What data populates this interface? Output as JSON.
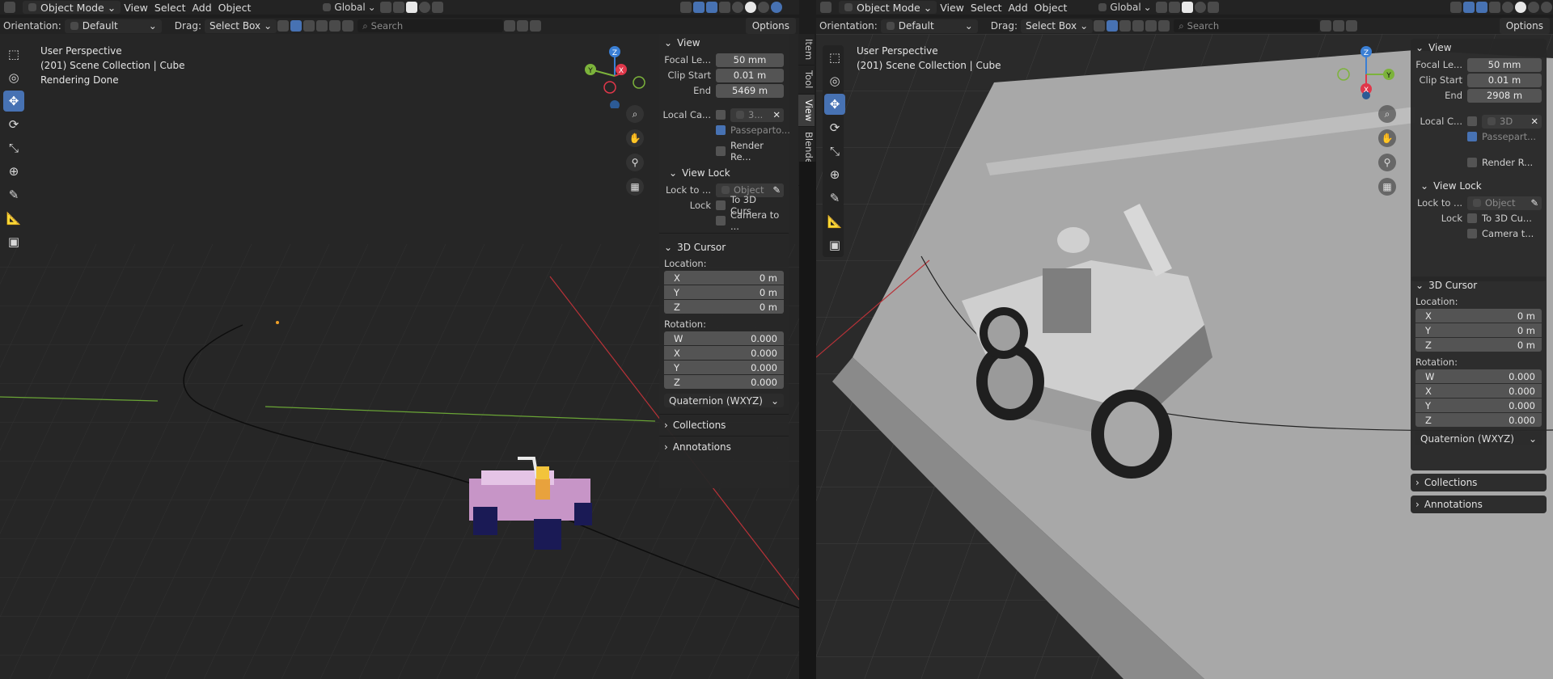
{
  "left": {
    "header": {
      "mode": "Object Mode",
      "menus": [
        "View",
        "Select",
        "Add",
        "Object"
      ],
      "transform": "Global",
      "search_placeholder": "Search",
      "orientation_label": "Orientation:",
      "orientation_value": "Default",
      "drag_label": "Drag:",
      "drag_value": "Select Box",
      "options": "Options"
    },
    "overlay_text": [
      "User Perspective",
      "(201) Scene Collection | Cube",
      "Rendering Done"
    ],
    "tabs": [
      "Item",
      "Tool",
      "View",
      "BlenderKit"
    ],
    "panel": {
      "view_title": "View",
      "focal_label": "Focal Le...",
      "focal_value": "50 mm",
      "clip_start_label": "Clip Start",
      "clip_start_value": "0.01 m",
      "end_label": "End",
      "end_value": "5469 m",
      "local_camera_label": "Local Ca...",
      "local_camera_value": "3...",
      "passepartout_label": "Passeparto...",
      "render_region_label": "Render Re...",
      "view_lock_title": "View Lock",
      "lock_to_label": "Lock to ...",
      "lock_to_value": "Object",
      "lock_label": "Lock",
      "to_3d_cursor_label": "To 3D Curs...",
      "camera_to_label": "Camera to ...",
      "cursor_title": "3D Cursor",
      "location_label": "Location:",
      "loc": [
        {
          "axis": "X",
          "value": "0 m"
        },
        {
          "axis": "Y",
          "value": "0 m"
        },
        {
          "axis": "Z",
          "value": "0 m"
        }
      ],
      "rotation_label": "Rotation:",
      "rot": [
        {
          "axis": "W",
          "value": "0.000"
        },
        {
          "axis": "X",
          "value": "0.000"
        },
        {
          "axis": "Y",
          "value": "0.000"
        },
        {
          "axis": "Z",
          "value": "0.000"
        }
      ],
      "rotation_mode": "Quaternion (WXYZ)",
      "collections": "Collections",
      "annotations": "Annotations"
    }
  },
  "right": {
    "header": {
      "mode": "Object Mode",
      "menus": [
        "View",
        "Select",
        "Add",
        "Object"
      ],
      "transform": "Global",
      "search_placeholder": "Search",
      "orientation_label": "Orientation:",
      "orientation_value": "Default",
      "drag_label": "Drag:",
      "drag_value": "Select Box",
      "options": "Options"
    },
    "overlay_text": [
      "User Perspective",
      "(201) Scene Collection | Cube"
    ],
    "panel": {
      "view_title": "View",
      "focal_label": "Focal Le...",
      "focal_value": "50 mm",
      "clip_start_label": "Clip Start",
      "clip_start_value": "0.01 m",
      "end_label": "End",
      "end_value": "2908 m",
      "local_camera_label": "Local C...",
      "local_camera_value": "3D",
      "passepartout_label": "Passepart...",
      "render_region_label": "Render R...",
      "view_lock_title": "View Lock",
      "lock_to_label": "Lock to ...",
      "lock_to_value": "Object",
      "lock_label": "Lock",
      "to_3d_cursor_label": "To 3D Cu...",
      "camera_to_label": "Camera t...",
      "cursor_title": "3D Cursor",
      "location_label": "Location:",
      "loc": [
        {
          "axis": "X",
          "value": "0 m"
        },
        {
          "axis": "Y",
          "value": "0 m"
        },
        {
          "axis": "Z",
          "value": "0 m"
        }
      ],
      "rotation_label": "Rotation:",
      "rot": [
        {
          "axis": "W",
          "value": "0.000"
        },
        {
          "axis": "X",
          "value": "0.000"
        },
        {
          "axis": "Y",
          "value": "0.000"
        },
        {
          "axis": "Z",
          "value": "0.000"
        }
      ],
      "rotation_mode": "Quaternion (WXYZ)",
      "collections": "Collections",
      "annotations": "Annotations"
    }
  },
  "gizmo": {
    "x": "X",
    "y": "Y",
    "z": "Z"
  },
  "colors": {
    "accent": "#4772b3",
    "axis_x": "#e0374a",
    "axis_y": "#7cb33b",
    "axis_z": "#3a7fd5"
  }
}
